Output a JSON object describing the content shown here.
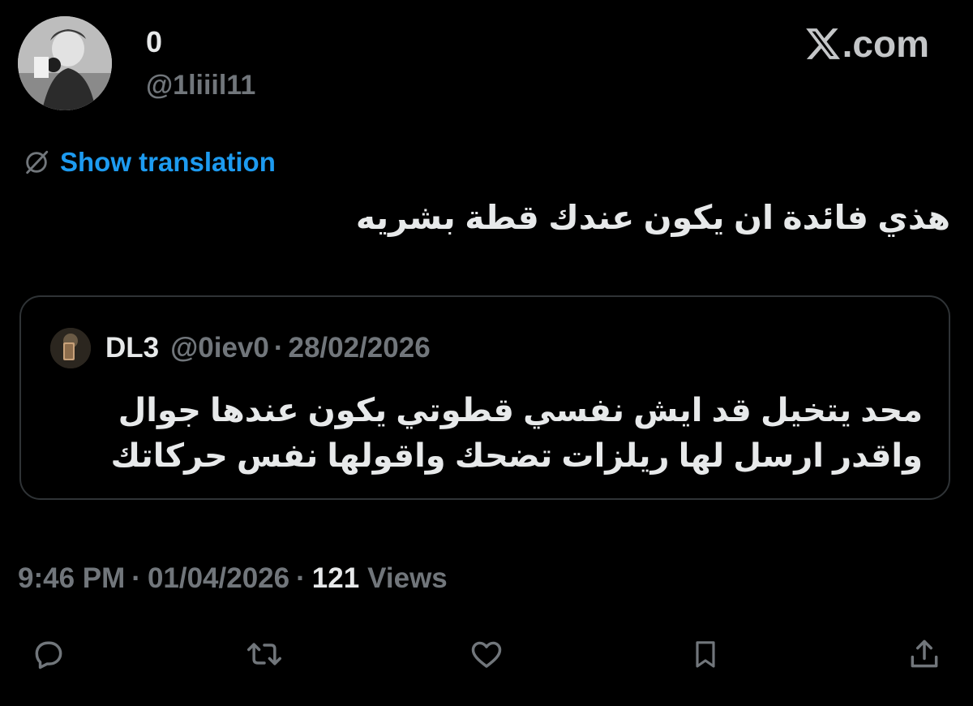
{
  "header": {
    "display_name": "0",
    "handle": "@1liiil11",
    "brand_text": ".com",
    "brand_icon": "x-logo-icon"
  },
  "translation": {
    "label": "Show translation",
    "icon": "globe-slash-icon"
  },
  "tweet": {
    "text": "هذي فائدة ان يكون عندك قطة بشريه"
  },
  "quote": {
    "name": "DL3",
    "handle": "@0iev0",
    "separator": "·",
    "date": "28/02/2026",
    "line1": "محد يتخيل قد ايش نفسي قطوتي يكون عندها جوال",
    "line2": "واقدر ارسل لها ريلزات تضحك واقولها نفس حركاتك"
  },
  "meta": {
    "time": "9:46 PM",
    "separator": "·",
    "date": "01/04/2026",
    "views_count": "121",
    "views_label": "Views"
  },
  "actions": [
    {
      "name": "reply",
      "icon": "reply-icon"
    },
    {
      "name": "retweet",
      "icon": "retweet-icon"
    },
    {
      "name": "like",
      "icon": "like-icon"
    },
    {
      "name": "bookmark",
      "icon": "bookmark-icon"
    },
    {
      "name": "share",
      "icon": "share-icon"
    }
  ],
  "colors": {
    "background": "#000000",
    "text": "#e7e9ea",
    "muted": "#71767b",
    "link": "#1d9bf0",
    "border": "#2f3336"
  }
}
